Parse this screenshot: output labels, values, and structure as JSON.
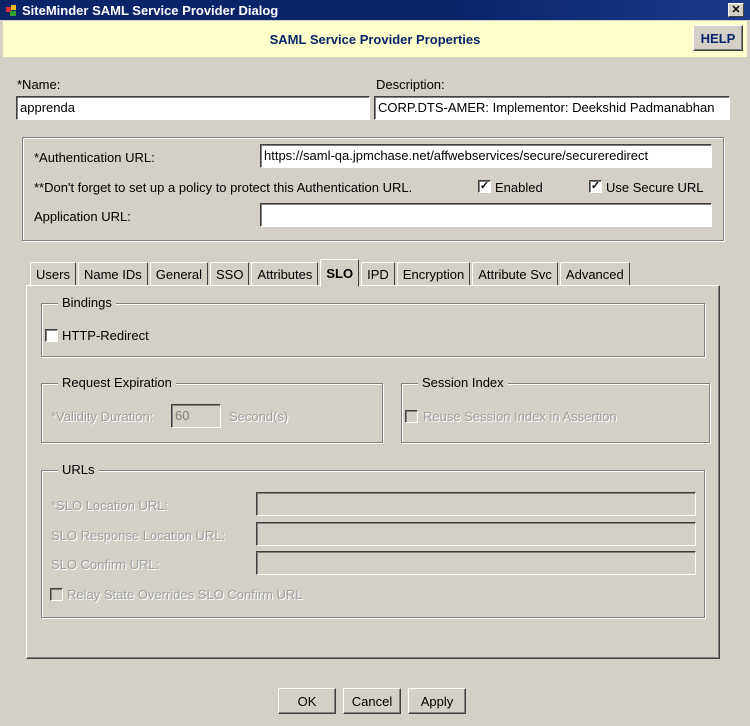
{
  "window": {
    "title": "SiteMinder SAML Service Provider Dialog",
    "close_glyph": "✕"
  },
  "header": {
    "title": "SAML Service Provider Properties",
    "help_label": "HELP"
  },
  "main": {
    "name_label": "*Name:",
    "name_value": "apprenda",
    "description_label": "Description:",
    "description_value": "CORP.DTS-AMER: Implementor: Deekshid Padmanabhan"
  },
  "auth": {
    "auth_url_label": "*Authentication URL:",
    "auth_url_value": "https://saml-qa.jpmchase.net/affwebservices/secure/secureredirect",
    "policy_note": "**Don't forget to set up a policy to protect this Authentication URL.",
    "enabled_label": "Enabled",
    "enabled_checked": true,
    "secure_url_label": "Use Secure URL",
    "secure_url_checked": true,
    "app_url_label": "Application URL:",
    "app_url_value": ""
  },
  "tabs": [
    {
      "label": "Users"
    },
    {
      "label": "Name IDs"
    },
    {
      "label": "General"
    },
    {
      "label": "SSO"
    },
    {
      "label": "Attributes"
    },
    {
      "label": "SLO",
      "active": true
    },
    {
      "label": "IPD"
    },
    {
      "label": "Encryption"
    },
    {
      "label": "Attribute Svc"
    },
    {
      "label": "Advanced"
    }
  ],
  "slo": {
    "bindings_title": "Bindings",
    "http_redirect_label": "HTTP-Redirect",
    "request_expiration_title": "Request Expiration",
    "validity_label": "*Validity Duration:",
    "validity_value": "60",
    "validity_unit": "Second(s)",
    "session_index_title": "Session Index",
    "reuse_session_label": "Reuse Session Index in Assertion",
    "urls_title": "URLs",
    "slo_location_label": "*SLO Location URL:",
    "slo_response_label": "SLO Response Location URL:",
    "slo_confirm_label": "SLO Confirm URL:",
    "relay_state_label": "Relay State Overrides SLO Confirm URL"
  },
  "footer": {
    "ok_label": "OK",
    "cancel_label": "Cancel",
    "apply_label": "Apply"
  }
}
